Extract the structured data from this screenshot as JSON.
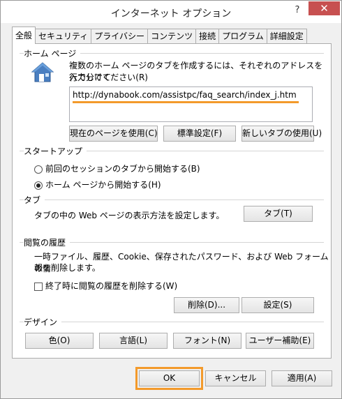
{
  "window": {
    "title": "インターネット オプション",
    "help_label": "?",
    "close_label": "✕",
    "accent_color": "#c75050",
    "highlight_color": "#f39a2b"
  },
  "tabs": [
    {
      "label": "全般",
      "active": true
    },
    {
      "label": "セキュリティ",
      "active": false
    },
    {
      "label": "プライバシー",
      "active": false
    },
    {
      "label": "コンテンツ",
      "active": false
    },
    {
      "label": "接続",
      "active": false
    },
    {
      "label": "プログラム",
      "active": false
    },
    {
      "label": "詳細設定",
      "active": false
    }
  ],
  "home_page": {
    "section_title": "ホーム ページ",
    "icon": "house-icon",
    "description_line1": "複数のホーム ページのタブを作成するには、それぞれのアドレスを行で分けて",
    "description_line2": "入力してください(R)",
    "url_value": "http://dynabook.com/assistpc/faq_search/index_j.htm",
    "use_current_label": "現在のページを使用(C)",
    "use_default_label": "標準設定(F)",
    "use_new_tab_label": "新しいタブの使用(U)"
  },
  "startup": {
    "section_title": "スタートアップ",
    "option_previous": "前回のセッションのタブから開始する(B)",
    "option_home": "ホーム ページから開始する(H)",
    "selected": "home"
  },
  "tabs_section": {
    "section_title": "タブ",
    "description": "タブの中の Web ページの表示方法を設定します。",
    "button_label": "タブ(T)"
  },
  "history": {
    "section_title": "閲覧の履歴",
    "description_line1": "一時ファイル、履歴、Cookie、保存されたパスワード、および Web フォームの情",
    "description_line2": "報を削除します。",
    "delete_on_exit_label": "終了時に閲覧の履歴を削除する(W)",
    "delete_on_exit_checked": false,
    "delete_label": "削除(D)...",
    "settings_label": "設定(S)"
  },
  "appearance": {
    "section_title": "デザイン",
    "colors_label": "色(O)",
    "languages_label": "言語(L)",
    "fonts_label": "フォント(N)",
    "accessibility_label": "ユーザー補助(E)"
  },
  "footer": {
    "ok_label": "OK",
    "cancel_label": "キャンセル",
    "apply_label": "適用(A)"
  }
}
